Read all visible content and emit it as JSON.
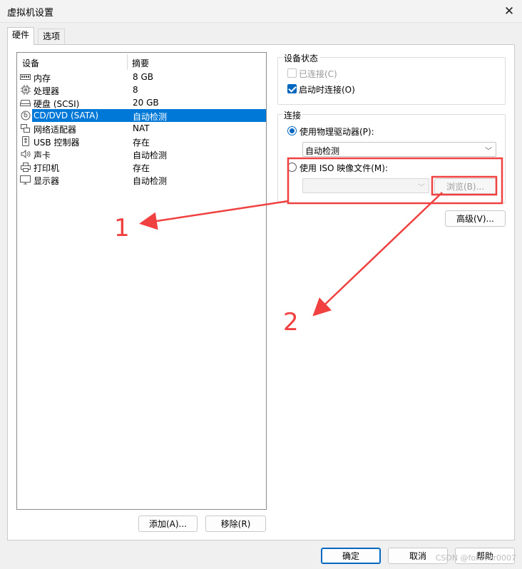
{
  "window": {
    "title": "虚拟机设置",
    "close_glyph": "✕"
  },
  "tabs": [
    {
      "label": "硬件"
    },
    {
      "label": "选项"
    }
  ],
  "device_list": {
    "headers": {
      "device": "设备",
      "summary": "摘要"
    },
    "rows": [
      {
        "name": "内存",
        "summary": "8 GB",
        "icon": "memory-icon"
      },
      {
        "name": "处理器",
        "summary": "8",
        "icon": "processor-icon"
      },
      {
        "name": "硬盘 (SCSI)",
        "summary": "20 GB",
        "icon": "hard-disk-icon"
      },
      {
        "name": "CD/DVD (SATA)",
        "summary": "自动检测",
        "icon": "cd-dvd-icon",
        "selected": true
      },
      {
        "name": "网络适配器",
        "summary": "NAT",
        "icon": "network-adapter-icon"
      },
      {
        "name": "USB 控制器",
        "summary": "存在",
        "icon": "usb-controller-icon"
      },
      {
        "name": "声卡",
        "summary": "自动检测",
        "icon": "sound-card-icon"
      },
      {
        "name": "打印机",
        "summary": "存在",
        "icon": "printer-icon"
      },
      {
        "name": "显示器",
        "summary": "自动检测",
        "icon": "display-icon"
      }
    ],
    "add_button": "添加(A)...",
    "remove_button": "移除(R)"
  },
  "device_status": {
    "title": "设备状态",
    "connected": {
      "label": "已连接(C)",
      "checked": false,
      "enabled": false
    },
    "connect_at_power_on": {
      "label": "启动时连接(O)",
      "checked": true,
      "enabled": true
    }
  },
  "connection": {
    "title": "连接",
    "use_physical": {
      "label": "使用物理驱动器(P):",
      "selected": true
    },
    "physical_drive_value": "自动检测",
    "use_iso": {
      "label": "使用 ISO 映像文件(M):",
      "selected": false
    },
    "iso_path_value": "",
    "browse_button": "浏览(B)...",
    "advanced_button": "高级(V)..."
  },
  "footer": {
    "ok_button": "确定",
    "cancel_button": "取消",
    "help_button": "帮助"
  },
  "annotations": {
    "label_1": "1",
    "label_2": "2",
    "color": "#f04040"
  },
  "watermark": "CSDN @forever0007"
}
